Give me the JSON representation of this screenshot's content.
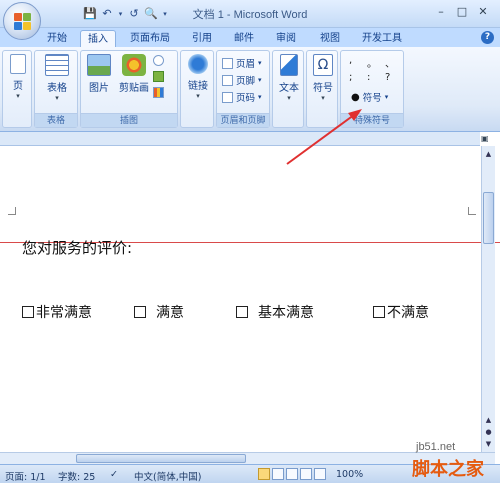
{
  "window": {
    "title": "文档 1 - Microsoft Word"
  },
  "quick_access": {
    "icons": [
      "save-icon",
      "undo-icon",
      "redo-icon",
      "print-preview-icon"
    ]
  },
  "tabs": [
    {
      "label": "开始"
    },
    {
      "label": "插入",
      "active": true
    },
    {
      "label": "页面布局"
    },
    {
      "label": "引用"
    },
    {
      "label": "邮件"
    },
    {
      "label": "审阅"
    },
    {
      "label": "视图"
    },
    {
      "label": "开发工具"
    }
  ],
  "ribbon": {
    "page_btn": "页",
    "table": {
      "btn": "表格",
      "group": "表格"
    },
    "illustrations": {
      "picture": "图片",
      "clipart": "剪贴画",
      "group": "插图"
    },
    "links": {
      "btn": "链接"
    },
    "header_footer": {
      "header": "页眉",
      "footer": "页脚",
      "page_number": "页码",
      "group": "页眉和页脚"
    },
    "text": {
      "btn": "文本"
    },
    "symbols": {
      "btn": "符号"
    },
    "special_chars": {
      "row1": [
        ",",
        "。",
        "、"
      ],
      "row2": [
        ";",
        ":",
        "?"
      ],
      "btn": "符号",
      "group": "特殊符号"
    }
  },
  "document": {
    "question": "您对服务的评价:",
    "options": [
      "非常满意",
      "满意",
      "基本满意",
      "不满意"
    ]
  },
  "status": {
    "page": "页面: 1/1",
    "words": "字数: 25",
    "language": "中文(简体,中国)",
    "zoom": "100%"
  },
  "watermark": {
    "site": "jb51.net",
    "name": "脚本之家"
  },
  "colors": {
    "accent": "#15428b",
    "ribbon_bg": "#dfeaf8",
    "arrow": "#e03030",
    "red_line": "#d94a4a"
  }
}
